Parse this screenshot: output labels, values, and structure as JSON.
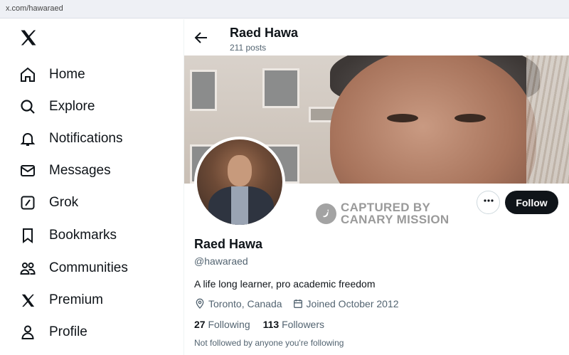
{
  "browser": {
    "url": "x.com/hawaraed"
  },
  "sidebar": {
    "logo_icon": "x-logo-icon",
    "items": [
      {
        "label": "Home",
        "icon": "home-icon"
      },
      {
        "label": "Explore",
        "icon": "search-icon"
      },
      {
        "label": "Notifications",
        "icon": "bell-icon"
      },
      {
        "label": "Messages",
        "icon": "mail-icon"
      },
      {
        "label": "Grok",
        "icon": "grok-icon"
      },
      {
        "label": "Bookmarks",
        "icon": "bookmark-icon"
      },
      {
        "label": "Communities",
        "icon": "communities-icon"
      },
      {
        "label": "Premium",
        "icon": "x-logo-icon"
      },
      {
        "label": "Profile",
        "icon": "person-icon"
      }
    ]
  },
  "header": {
    "name": "Raed Hawa",
    "posts": "211 posts"
  },
  "watermark": {
    "line1": "CAPTURED BY",
    "line2": "CANARY MISSION"
  },
  "actions": {
    "follow_label": "Follow",
    "more_icon": "more-dots-icon"
  },
  "profile": {
    "name": "Raed Hawa",
    "handle": "@hawaraed",
    "bio": "A life long learner, pro academic freedom",
    "location": "Toronto, Canada",
    "joined": "Joined October 2012",
    "following_count": "27",
    "following_label": "Following",
    "followers_count": "113",
    "followers_label": "Followers",
    "note": "Not followed by anyone you're following"
  },
  "colors": {
    "accent": "#0f1419",
    "secondary_text": "#536471"
  }
}
